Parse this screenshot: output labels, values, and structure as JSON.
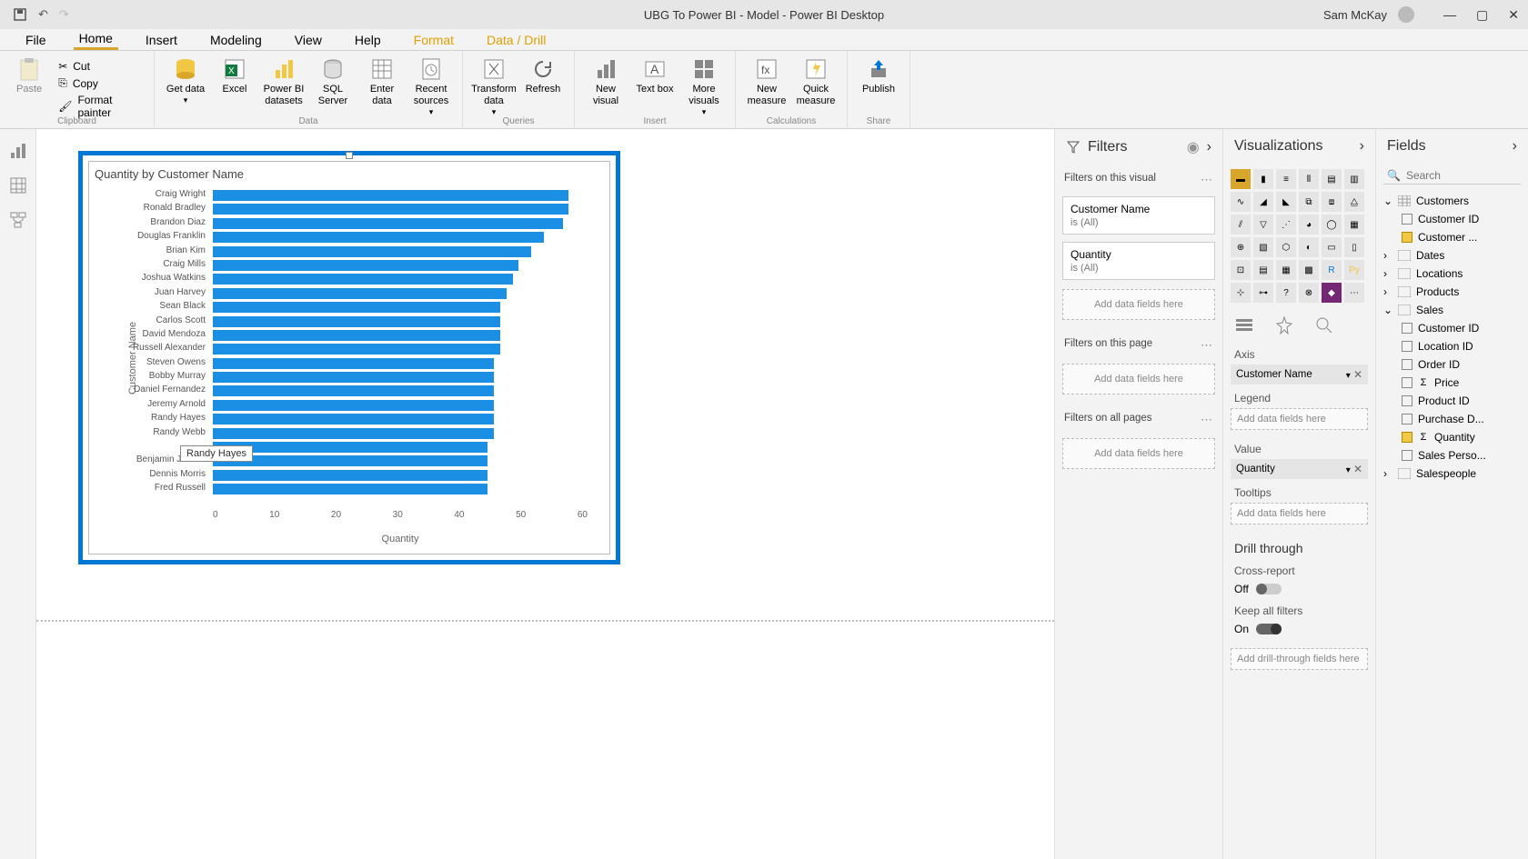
{
  "title_bar": {
    "title": "UBG To Power BI - Model - Power BI Desktop",
    "user": "Sam McKay"
  },
  "menus": {
    "file": "File",
    "home": "Home",
    "insert": "Insert",
    "modeling": "Modeling",
    "view": "View",
    "help": "Help",
    "format": "Format",
    "data_drill": "Data / Drill"
  },
  "ribbon": {
    "clipboard": {
      "label": "Clipboard",
      "paste": "Paste",
      "cut": "Cut",
      "copy": "Copy",
      "format_painter": "Format painter"
    },
    "data": {
      "label": "Data",
      "get_data": "Get data",
      "excel": "Excel",
      "pbi_ds": "Power BI datasets",
      "sql": "SQL Server",
      "enter": "Enter data",
      "recent": "Recent sources"
    },
    "queries": {
      "label": "Queries",
      "transform": "Transform data",
      "refresh": "Refresh"
    },
    "insert": {
      "label": "Insert",
      "new_visual": "New visual",
      "text_box": "Text box",
      "more": "More visuals"
    },
    "calculations": {
      "label": "Calculations",
      "new_measure": "New measure",
      "quick": "Quick measure"
    },
    "share": {
      "label": "Share",
      "publish": "Publish"
    }
  },
  "chart": {
    "title": "Quantity by Customer Name",
    "y_axis_title": "Customer Name",
    "x_axis_title": "Quantity",
    "tooltip": "Randy Hayes"
  },
  "chart_data": {
    "type": "bar",
    "orientation": "horizontal",
    "xlabel": "Quantity",
    "ylabel": "Customer Name",
    "xlim": [
      0,
      60
    ],
    "x_ticks": [
      0,
      10,
      20,
      30,
      40,
      50,
      60
    ],
    "categories": [
      "Craig Wright",
      "Ronald Bradley",
      "Brandon Diaz",
      "Douglas Franklin",
      "Brian Kim",
      "Craig Mills",
      "Joshua Watkins",
      "Juan Harvey",
      "Sean Black",
      "Carlos Scott",
      "David Mendoza",
      "Russell Alexander",
      "Steven Owens",
      "Bobby Murray",
      "Daniel Fernandez",
      "Jeremy Arnold",
      "Randy Hayes",
      "Randy Webb",
      "",
      "Benjamin Jacobs",
      "Dennis Morris",
      "Fred Russell"
    ],
    "values": [
      57,
      57,
      56,
      53,
      51,
      49,
      48,
      47,
      46,
      46,
      46,
      46,
      45,
      45,
      45,
      45,
      45,
      45,
      44,
      44,
      44,
      44
    ]
  },
  "filters": {
    "title": "Filters",
    "on_visual": "Filters on this visual",
    "card1_name": "Customer Name",
    "card1_sub": "is (All)",
    "card2_name": "Quantity",
    "card2_sub": "is (All)",
    "add": "Add data fields here",
    "on_page": "Filters on this page",
    "on_all": "Filters on all pages"
  },
  "viz": {
    "title": "Visualizations",
    "axis": "Axis",
    "axis_field": "Customer Name",
    "legend": "Legend",
    "legend_drop": "Add data fields here",
    "value": "Value",
    "value_field": "Quantity",
    "tooltips": "Tooltips",
    "tooltips_drop": "Add data fields here",
    "drill": "Drill through",
    "cross": "Cross-report",
    "cross_val": "Off",
    "keep": "Keep all filters",
    "keep_val": "On",
    "drill_drop": "Add drill-through fields here"
  },
  "fields": {
    "title": "Fields",
    "search": "Search",
    "tables": {
      "customers": "Customers",
      "customer_id": "Customer ID",
      "customer_name": "Customer ...",
      "dates": "Dates",
      "locations": "Locations",
      "products": "Products",
      "sales": "Sales",
      "s_customer_id": "Customer ID",
      "location_id": "Location ID",
      "order_id": "Order ID",
      "price": "Price",
      "product_id": "Product ID",
      "purchase_d": "Purchase D...",
      "quantity": "Quantity",
      "sales_perso": "Sales Perso...",
      "salespeople": "Salespeople"
    }
  }
}
